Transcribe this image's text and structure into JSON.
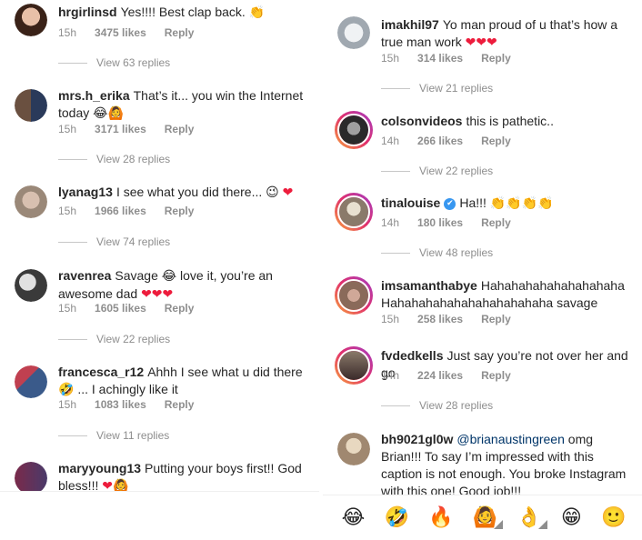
{
  "left": [
    {
      "user": "hrgirlinsd",
      "text": "Yes!!!! Best clap back.",
      "emoji": "👏",
      "time": "15h",
      "likes": "3475 likes",
      "reply": "Reply",
      "view": "View 63 replies",
      "avatar_color": "#6b3a2a"
    },
    {
      "user": "mrs.h_erika",
      "text": "That’s it... you win the Internet today",
      "emoji": "😂🙆",
      "time": "15h",
      "likes": "3171 likes",
      "reply": "Reply",
      "view": "View 28 replies",
      "avatar_color": "#3a4a6b"
    },
    {
      "user": "lyanag13",
      "text": "I see what you did there...",
      "emoji": "😉",
      "heart": "❤",
      "time": "15h",
      "likes": "1966 likes",
      "reply": "Reply",
      "view": "View 74 replies",
      "avatar_color": "#b8a898"
    },
    {
      "user": "ravenrea",
      "text": "Savage",
      "emoji": "😂",
      "text2": "love it, you’re an awesome dad",
      "hearts": "❤❤❤",
      "time": "15h",
      "likes": "1605 likes",
      "reply": "Reply",
      "view": "View 22 replies",
      "avatar_color": "#5a5a5a"
    },
    {
      "user": "francesca_r12",
      "text": "Ahhh I see what u did there",
      "emoji": "🤣",
      "text2": "... I achingly like  it",
      "time": "15h",
      "likes": "1083 likes",
      "reply": "Reply",
      "view": "View 11 replies",
      "avatar_color": "#8a3a4a"
    },
    {
      "user": "maryyoung13",
      "text": "Putting your boys first!! God bless!!!",
      "hearts": "❤",
      "emoji": "🙆",
      "avatar_color": "#6a3a5a"
    }
  ],
  "right": [
    {
      "user": "imakhil97",
      "text": "Yo man proud of u that’s how a true man work",
      "hearts": "❤❤❤",
      "time": "15h",
      "likes": "314 likes",
      "reply": "Reply",
      "view": "View 21 replies",
      "avatar_color": "#d8dde2"
    },
    {
      "user": "colsonvideos",
      "text": "this is pathetic..",
      "time": "14h",
      "likes": "266 likes",
      "reply": "Reply",
      "view": "View 22 replies",
      "avatar_color": "#4a4a4a"
    },
    {
      "user": "tinalouise",
      "text": "Ha!!!",
      "emoji": "👏👏👏👏",
      "time": "14h",
      "likes": "180 likes",
      "reply": "Reply",
      "view": "View 48 replies",
      "avatar_color": "#c8c0b0"
    },
    {
      "user": "imsamanthabye",
      "text": "Hahahahahahahahahaha Hahahahahahahahahahahaha savage",
      "time": "15h",
      "likes": "258 likes",
      "reply": "Reply",
      "avatar_color": "#b89080"
    },
    {
      "user": "fvdedkells",
      "text": "Just say you’re not over her and go",
      "time": "14h",
      "likes": "224 likes",
      "reply": "Reply",
      "view": "View 28 replies",
      "avatar_color": "#7a6a5a"
    },
    {
      "user": "bh9021gl0w",
      "mention": "@brianaustingreen",
      "text": "omg Brian!!! To say I’m impressed with this caption is not enough. You broke Instagram with this one! Good job!!!",
      "avatar_color": "#c8b8a0"
    }
  ],
  "emoji_bar": [
    "😂",
    "🤣",
    "🔥",
    "🙆",
    "👌",
    "😁",
    "🙂"
  ]
}
